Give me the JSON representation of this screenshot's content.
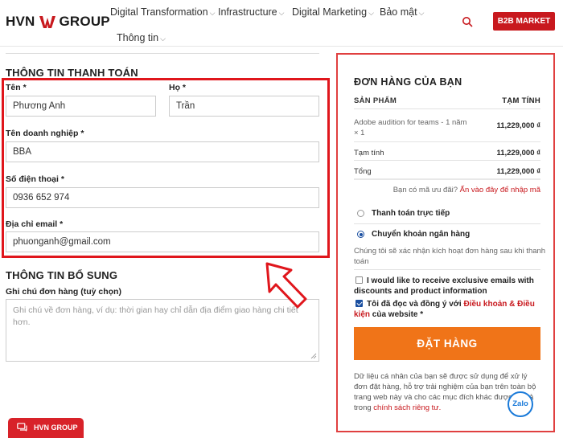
{
  "header": {
    "logo_left": "HVN",
    "logo_right": "GROUP",
    "nav": [
      {
        "label": "Digital Transformation"
      },
      {
        "label": "Infrastructure"
      },
      {
        "label": "Digital Marketing"
      },
      {
        "label": "Bảo mật"
      },
      {
        "label": "Thông tin"
      }
    ],
    "b2b_label": "B2B MARKET"
  },
  "billing": {
    "title": "THÔNG TIN THANH TOÁN",
    "first_name_label": "Tên *",
    "first_name_value": "Phương Anh",
    "last_name_label": "Họ *",
    "last_name_value": "Trần",
    "company_label": "Tên doanh nghiệp *",
    "company_value": "BBA",
    "phone_label": "Số điện thoại *",
    "phone_value": "0936 652 974",
    "email_label": "Địa chỉ email *",
    "email_value": "phuonganh@gmail.com"
  },
  "extra": {
    "title": "THÔNG TIN BỔ SUNG",
    "notes_label": "Ghi chú đơn hàng (tuỳ chọn)",
    "notes_placeholder": "Ghi chú về đơn hàng, ví dụ: thời gian hay chỉ dẫn địa điểm giao hàng chi tiết hơn."
  },
  "order": {
    "title": "ĐƠN HÀNG CỦA BẠN",
    "col_product": "SẢN PHẨM",
    "col_subtotal": "TẠM TÍNH",
    "item_name": "Adobe audition for teams - 1 năm",
    "item_qty": "× 1",
    "item_price": "11,229,000 ₫",
    "subtotal_label": "Tạm tính",
    "subtotal_value": "11,229,000 ₫",
    "total_label": "Tổng",
    "total_value": "11,229,000 ₫",
    "coupon_text": "Bạn có mã ưu đãi?",
    "coupon_link": "Ấn vào đây để nhập mã",
    "pay_direct": "Thanh toán trực tiếp",
    "pay_bank": "Chuyển khoản ngân hàng",
    "pay_note": "Chúng tôi sẽ xác nhận kích hoạt đơn hàng sau khi thanh toán",
    "newsletter": "I would like to receive exclusive emails with discounts and product information",
    "terms_prefix": "Tôi đã đọc và đồng ý với",
    "terms_link": "Điều khoản & Điều kiện",
    "terms_suffix": "của website *",
    "order_button": "ĐẶT HÀNG",
    "privacy_text": "Dữ liệu cá nhân của bạn sẽ được sử dụng để xử lý đơn đặt hàng, hỗ trợ trải nghiệm của bạn trên toàn bộ trang web này và cho các mục đích khác được mô tả trong",
    "privacy_link": "chính sách riêng tư."
  },
  "widgets": {
    "zalo": "Zalo",
    "chat": "HVN GROUP"
  },
  "colors": {
    "brand_red": "#c8191e",
    "highlight_red": "#e0161c",
    "order_orange": "#f07418",
    "radio_blue": "#1a4fa0"
  }
}
